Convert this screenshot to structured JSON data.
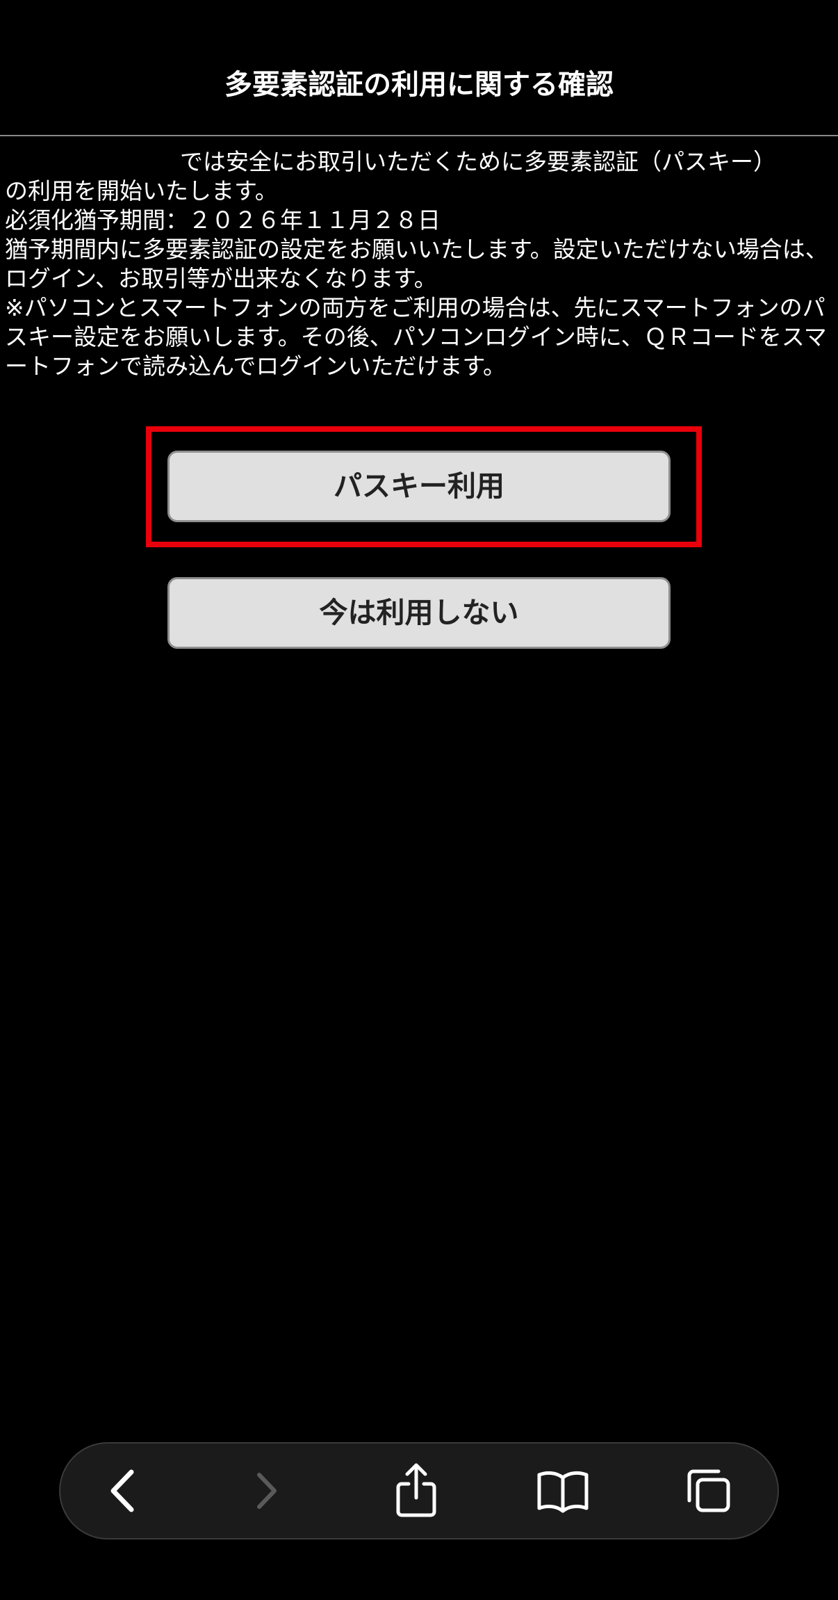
{
  "header": {
    "title": "多要素認証の利用に関する確認"
  },
  "notice": {
    "line1": "では安全にお取引いただくために多要素認証（パスキー）",
    "line2": "の利用を開始いたします。",
    "grace_period": "必須化猶予期間：２０２６年１１月２８日",
    "setup_request": "猶予期間内に多要素認証の設定をお願いいたします。設定いただけない場合は、ログイン、お取引等が出来なくなります。",
    "device_note": "※パソコンとスマートフォンの両方をご利用の場合は、先にスマートフォンのパスキー設定をお願いします。その後、パソコンログイン時に、ＱＲコードをスマートフォンで読み込んでログインいただけます。"
  },
  "buttons": {
    "use_passkey": "パスキー利用",
    "not_now": "今は利用しない"
  },
  "highlight": {
    "color": "#e8000b"
  },
  "toolbar": {
    "back_icon": "chevron-left-icon",
    "forward_icon": "chevron-right-icon",
    "share_icon": "share-icon",
    "bookmarks_icon": "book-icon",
    "tabs_icon": "tabs-icon"
  }
}
